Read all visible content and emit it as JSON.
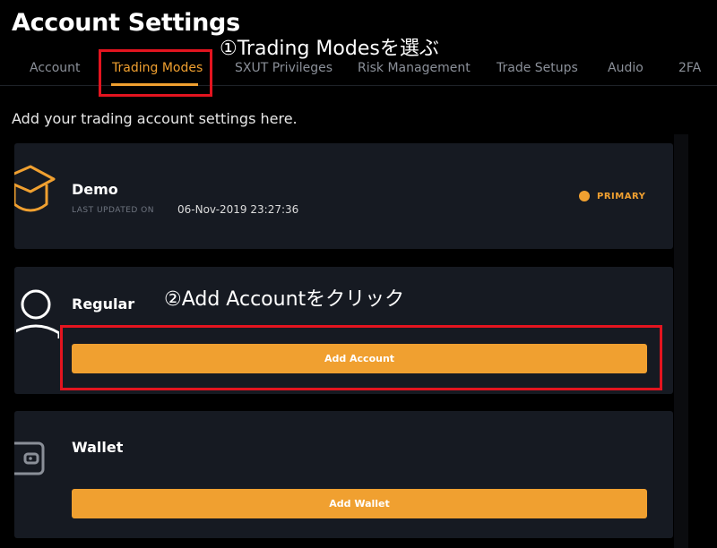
{
  "page": {
    "title": "Account Settings",
    "subtitle": "Add your trading account settings here."
  },
  "annotations": {
    "step1": "①Trading Modesを選ぶ",
    "step2": "②Add Accountをクリック"
  },
  "tabs": [
    {
      "label": "Account",
      "active": false
    },
    {
      "label": "Trading Modes",
      "active": true
    },
    {
      "label": "SXUT Privileges",
      "active": false
    },
    {
      "label": "Risk Management",
      "active": false
    },
    {
      "label": "Trade Setups",
      "active": false
    },
    {
      "label": "Audio",
      "active": false
    },
    {
      "label": "2FA",
      "active": false
    }
  ],
  "cards": {
    "demo": {
      "name": "Demo",
      "meta_label": "LAST UPDATED ON",
      "meta_value": "06-Nov-2019 23:27:36",
      "badge": "PRIMARY",
      "icon": "graduation-cap-icon"
    },
    "regular": {
      "name": "Regular",
      "button": "Add Account",
      "icon": "user-icon"
    },
    "wallet": {
      "name": "Wallet",
      "button": "Add Wallet",
      "icon": "wallet-icon"
    }
  },
  "colors": {
    "accent": "#f0a030",
    "card_bg": "#161a22",
    "highlight": "#e3141f",
    "background": "#000000"
  }
}
